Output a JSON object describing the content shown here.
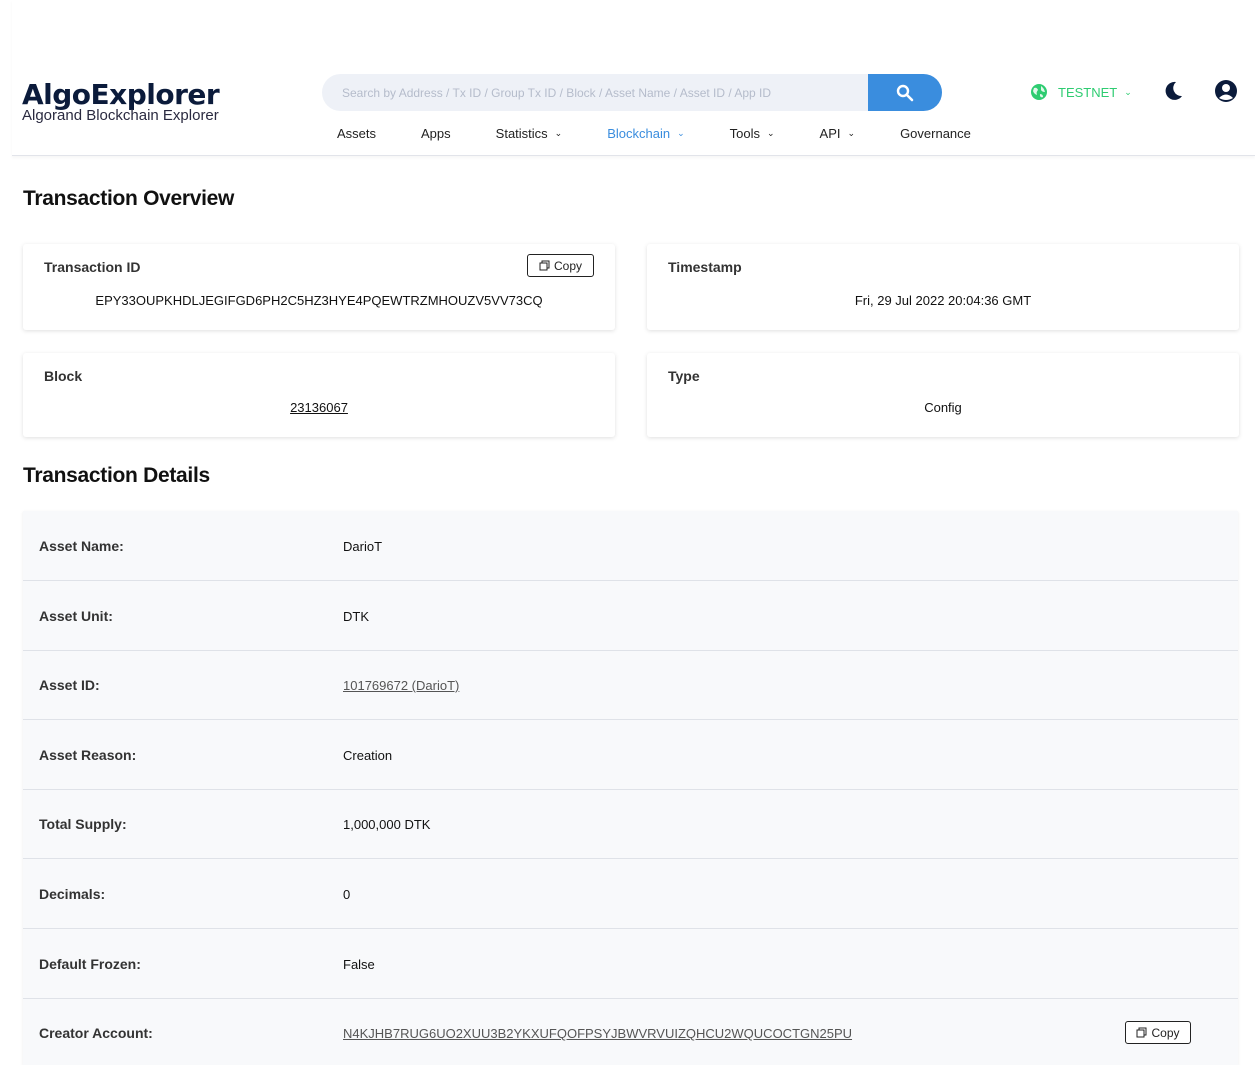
{
  "header": {
    "logo_name": "AlgoExplorer",
    "logo_sub": "Algorand Blockchain Explorer",
    "search_placeholder": "Search by Address / Tx ID / Group Tx ID / Block / Asset Name / Asset ID / App ID",
    "nav": [
      {
        "label": "Assets"
      },
      {
        "label": "Apps"
      },
      {
        "label": "Statistics"
      },
      {
        "label": "Blockchain"
      },
      {
        "label": "Tools"
      },
      {
        "label": "API"
      },
      {
        "label": "Governance"
      }
    ],
    "network_label": "TESTNET"
  },
  "overview": {
    "title": "Transaction Overview",
    "tx_id_label": "Transaction ID",
    "tx_id": "EPY33OUPKHDLJEGIFGD6PH2C5HZ3HYE4PQEWTRZMHOUZV5VV73CQ",
    "copy_label": "Copy",
    "timestamp_label": "Timestamp",
    "timestamp": "Fri, 29 Jul 2022 20:04:36 GMT",
    "block_label": "Block",
    "block": "23136067",
    "type_label": "Type",
    "type": "Config"
  },
  "details": {
    "title": "Transaction Details",
    "rows": [
      {
        "label": "Asset Name:",
        "value": "DarioT"
      },
      {
        "label": "Asset Unit:",
        "value": "DTK"
      },
      {
        "label": "Asset ID:",
        "value": "101769672 (DarioT)"
      },
      {
        "label": "Asset Reason:",
        "value": "Creation"
      },
      {
        "label": "Total Supply:",
        "value": "1,000,000 DTK"
      },
      {
        "label": "Decimals:",
        "value": "0"
      },
      {
        "label": "Default Frozen:",
        "value": "False"
      },
      {
        "label": "Creator Account:",
        "value": "N4KJHB7RUG6UO2XUU3B2YKXUFQOFPSYJBWVRVUIZQHCU2WQUCOCTGN25PU"
      }
    ],
    "copy_label": "Copy"
  },
  "colors": {
    "accent": "#3a8dde",
    "network": "#2ecc71",
    "arrow": "#4a7cc9"
  }
}
